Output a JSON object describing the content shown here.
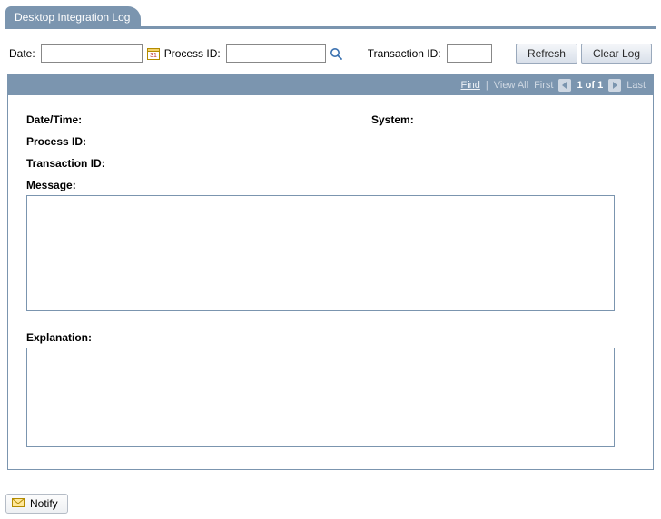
{
  "tab": {
    "title": "Desktop Integration Log"
  },
  "filters": {
    "date_label": "Date:",
    "date_value": "",
    "process_label": "Process ID:",
    "process_value": "",
    "txn_label": "Transaction ID:",
    "txn_value": ""
  },
  "actions": {
    "refresh": "Refresh",
    "clear_log": "Clear Log"
  },
  "grid_nav": {
    "find": "Find",
    "view_all": "View All",
    "first": "First",
    "counter": "1 of 1",
    "last": "Last"
  },
  "record": {
    "datetime_label": "Date/Time:",
    "datetime_value": "",
    "system_label": "System:",
    "system_value": "",
    "process_label": "Process ID:",
    "process_value": "",
    "txn_label": "Transaction ID:",
    "txn_value": "",
    "message_label": "Message:",
    "message_value": "",
    "explanation_label": "Explanation:",
    "explanation_value": ""
  },
  "footer": {
    "notify": "Notify"
  }
}
